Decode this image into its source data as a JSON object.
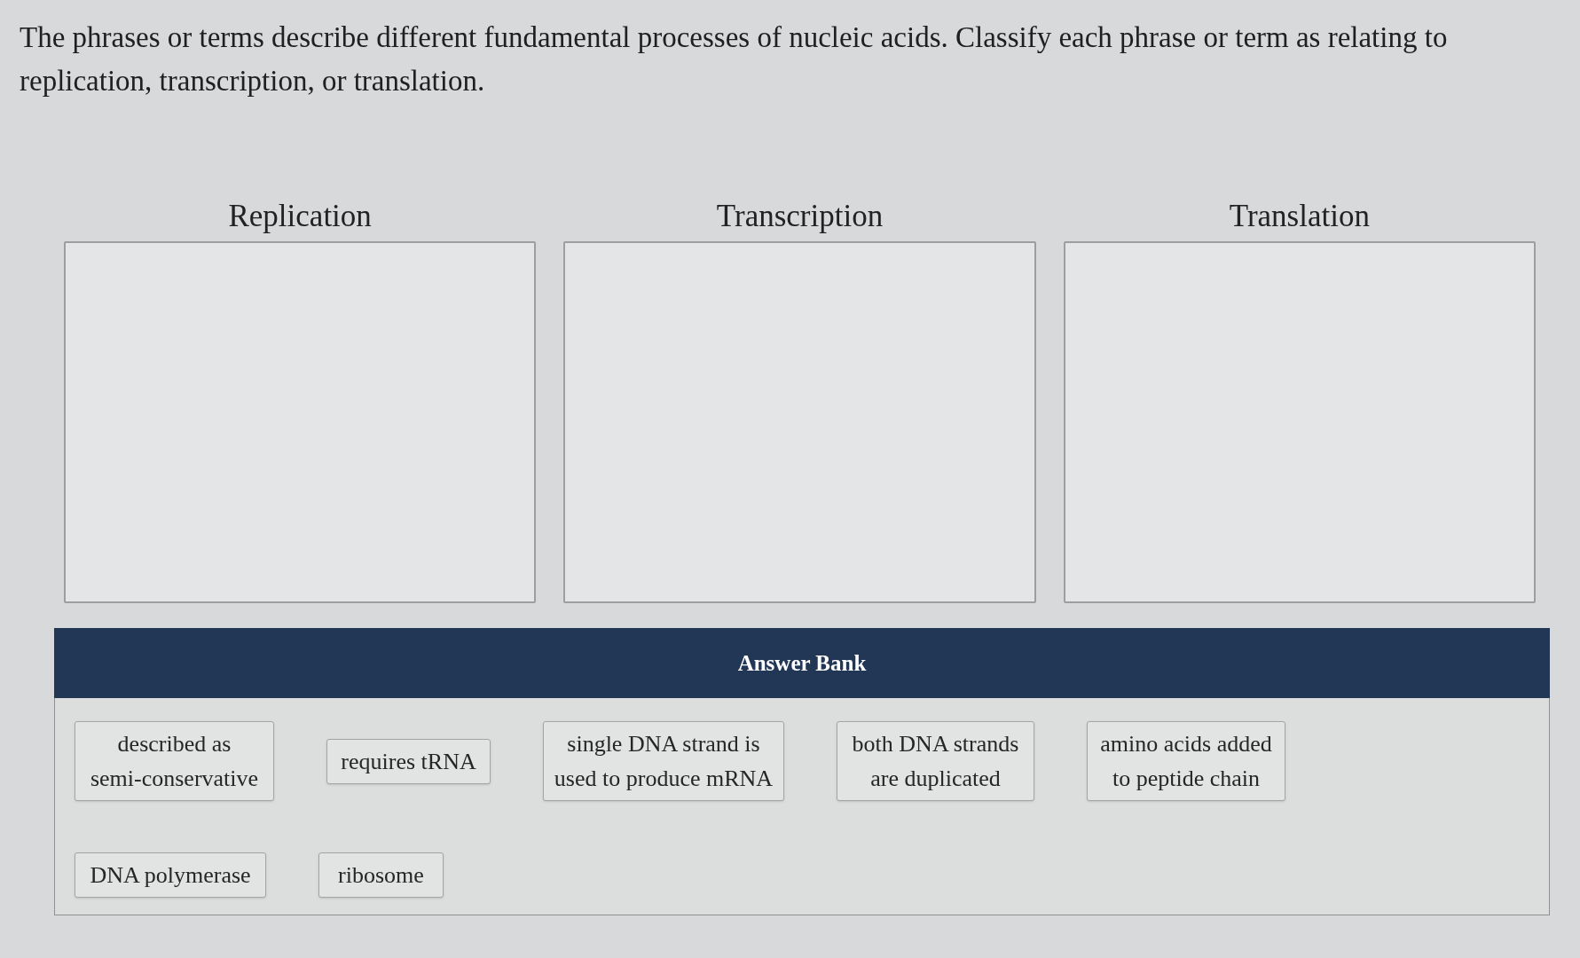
{
  "instructions": "The phrases or terms describe different fundamental processes of nucleic acids. Classify each phrase or term as relating to replication, transcription, or translation.",
  "categories": [
    {
      "label": "Replication"
    },
    {
      "label": "Transcription"
    },
    {
      "label": "Translation"
    }
  ],
  "answer_bank": {
    "title": "Answer Bank",
    "rows": [
      [
        "described as semi-conservative",
        "requires tRNA",
        "single DNA strand is used to produce mRNA",
        "both DNA strands are duplicated",
        "amino acids added to peptide chain"
      ],
      [
        "DNA polymerase",
        "ribosome"
      ]
    ]
  }
}
